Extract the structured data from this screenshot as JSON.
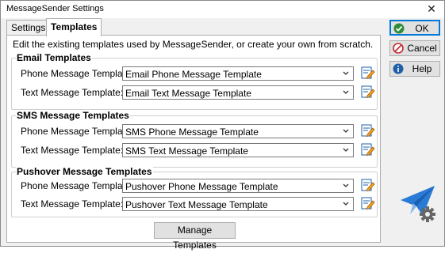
{
  "window": {
    "title": "MessageSender Settings"
  },
  "tabs": [
    {
      "label": "Settings",
      "active": false
    },
    {
      "label": "Templates",
      "active": true
    }
  ],
  "panel": {
    "intro": "Edit the existing templates used by MessageSender, or create your own from scratch.",
    "groups": [
      {
        "title": "Email Templates",
        "rows": [
          {
            "label": "Phone Message Template:",
            "value": "Email Phone Message Template"
          },
          {
            "label": "Text Message Template:",
            "value": "Email Text Message Template"
          }
        ]
      },
      {
        "title": "SMS Message Templates",
        "rows": [
          {
            "label": "Phone Message Template:",
            "value": "SMS Phone Message Template"
          },
          {
            "label": "Text Message Template:",
            "value": "SMS Text Message Template"
          }
        ]
      },
      {
        "title": "Pushover Message Templates",
        "rows": [
          {
            "label": "Phone Message Template:",
            "value": "Pushover Phone Message Template"
          },
          {
            "label": "Text Message Template:",
            "value": "Pushover Text Message Template"
          }
        ]
      }
    ],
    "manage_button": "Manage Templates"
  },
  "buttons": {
    "ok": {
      "label": "OK",
      "icon": "check-icon",
      "color": "#2e8b3a"
    },
    "cancel": {
      "label": "Cancel",
      "icon": "cancel-icon",
      "color": "#c0282d"
    },
    "help": {
      "label": "Help",
      "icon": "info-icon",
      "color": "#1e5fa8"
    }
  },
  "logo": {
    "icon": "paper-plane-gear-icon",
    "plane_color": "#2a7bd6",
    "gear_color": "#666666"
  }
}
